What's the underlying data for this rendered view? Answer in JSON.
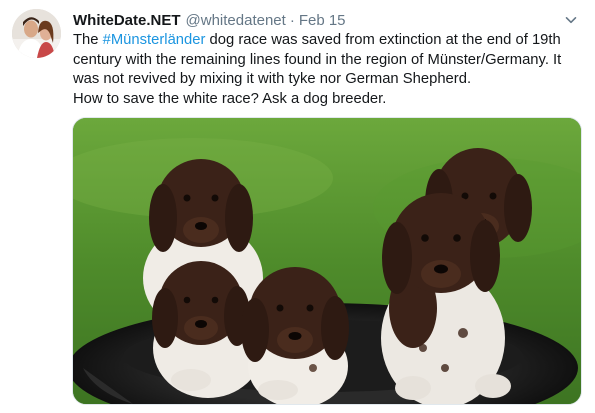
{
  "tweet": {
    "display_name": "WhiteDate.NET",
    "handle": "@whitedatenet",
    "separator": "·",
    "date": "Feb 15",
    "text_before_hashtag": "The ",
    "hashtag": "#Münsterländer",
    "text_after_hashtag": " dog race was saved from extinction at the end of 19th century with the remaining lines found in the region of Münster/Germany. It was not revived by mixing it with tyke nor German Shepherd.",
    "text_line_2": "How to save the white race? Ask a dog breeder."
  },
  "icons": {
    "menu": "chevron-down-icon"
  },
  "colors": {
    "link": "#1b95e0",
    "secondary_text": "#657786",
    "grass": "#4a8a2a"
  }
}
